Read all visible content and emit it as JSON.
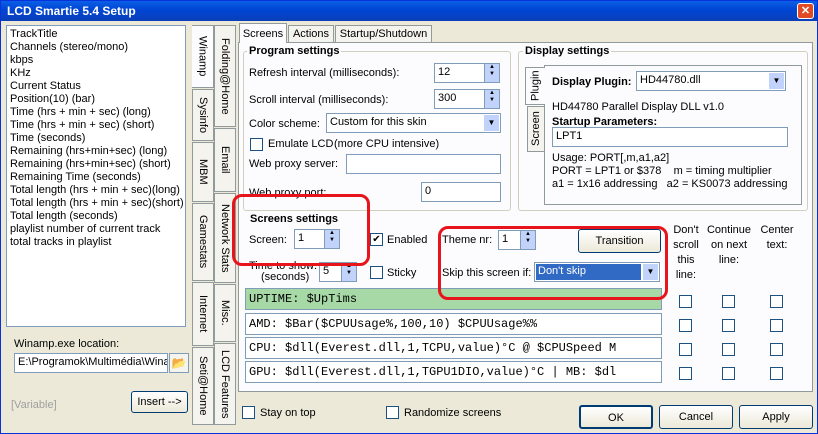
{
  "window": {
    "title": "LCD Smartie 5.4 Setup",
    "close": "✕"
  },
  "variables": [
    "TrackTitle",
    "Channels (stereo/mono)",
    "kbps",
    "KHz",
    "Current Status",
    "Position(10) (bar)",
    "Time (hrs + min + sec) (long)",
    "Time (hrs + min + sec) (short)",
    "Time (seconds)",
    "Remaining (hrs+min+sec) (long)",
    "Remaining (hrs+min+sec) (short)",
    "Remaining Time (seconds)",
    "Total length (hrs + min + sec)(long)",
    "Total length (hrs + min + sec)(short)",
    "Total length (seconds)",
    "playlist number of current track",
    "total tracks in playlist"
  ],
  "winamp": {
    "label": "Winamp.exe location:",
    "path": "E:\\Programok\\Multimédia\\Winamp",
    "variable": "[Variable]",
    "insert": "Insert -->"
  },
  "vtabs": {
    "winamp": "Winamp",
    "folding": "Folding@Home",
    "sysinfo": "Sysinfo",
    "email": "Email",
    "mbm": "MBM",
    "netstats": "Network Stats",
    "gamestats": "Gamestats",
    "misc": "Misc.",
    "internet": "Internet",
    "lcdfeatures": "LCD Features",
    "seti": "Seti@Home"
  },
  "tabs": {
    "screens": "Screens",
    "actions": "Actions",
    "startup": "Startup/Shutdown"
  },
  "program": {
    "title": "Program settings",
    "refresh_label": "Refresh interval (milliseconds):",
    "refresh": "12",
    "scroll_label": "Scroll interval (milliseconds):",
    "scroll": "300",
    "scheme_label": "Color scheme:",
    "scheme": "Custom for this skin",
    "emulate": "Emulate LCD",
    "emulate_note": "(more CPU intensive)",
    "proxy_server_label": "Web proxy server:",
    "proxy_server": "",
    "proxy_port_label": "Web proxy port:",
    "proxy_port": "0"
  },
  "display": {
    "title": "Display settings",
    "plugin_tab": "Plugin",
    "screen_tab": "Screen",
    "plugin_label": "Display Plugin:",
    "plugin": "HD44780.dll",
    "dll": "HD44780 Parallel Display DLL v1.0",
    "startup_label": "Startup Parameters:",
    "startup": "LPT1",
    "usage1": "Usage: PORT[,m,a1,a2]",
    "usage2": "PORT = LPT1 or $378    m = timing multiplier",
    "usage3": "a1 = 1x16 addressing   a2 = KS0073 addressing"
  },
  "screens": {
    "title": "Screens settings",
    "screen_label": "Screen:",
    "screen": "1",
    "enabled": "Enabled",
    "theme_label": "Theme nr:",
    "theme": "1",
    "transition": "Transition",
    "time_label1": "Time to show:",
    "time_label2": "(seconds)",
    "time": "5",
    "sticky": "Sticky",
    "skip_label": "Skip this screen if:",
    "skip": "Don't skip"
  },
  "cols": {
    "noscroll": "Don't scroll this line:",
    "continue": "Continue on next line:",
    "center": "Center text:"
  },
  "lines": [
    "UPTIME: $UpTims",
    "AMD: $Bar($CPUUsage%,100,10) $CPUUsage%%",
    "CPU: $dll(Everest.dll,1,TCPU,value)°C @ $CPUSpeed M",
    "GPU: $dll(Everest.dll,1,TGPU1DIO,value)°C | MB: $dl"
  ],
  "bottom": {
    "stay": "Stay on top",
    "randomize": "Randomize screens",
    "ok": "OK",
    "cancel": "Cancel",
    "apply": "Apply"
  }
}
